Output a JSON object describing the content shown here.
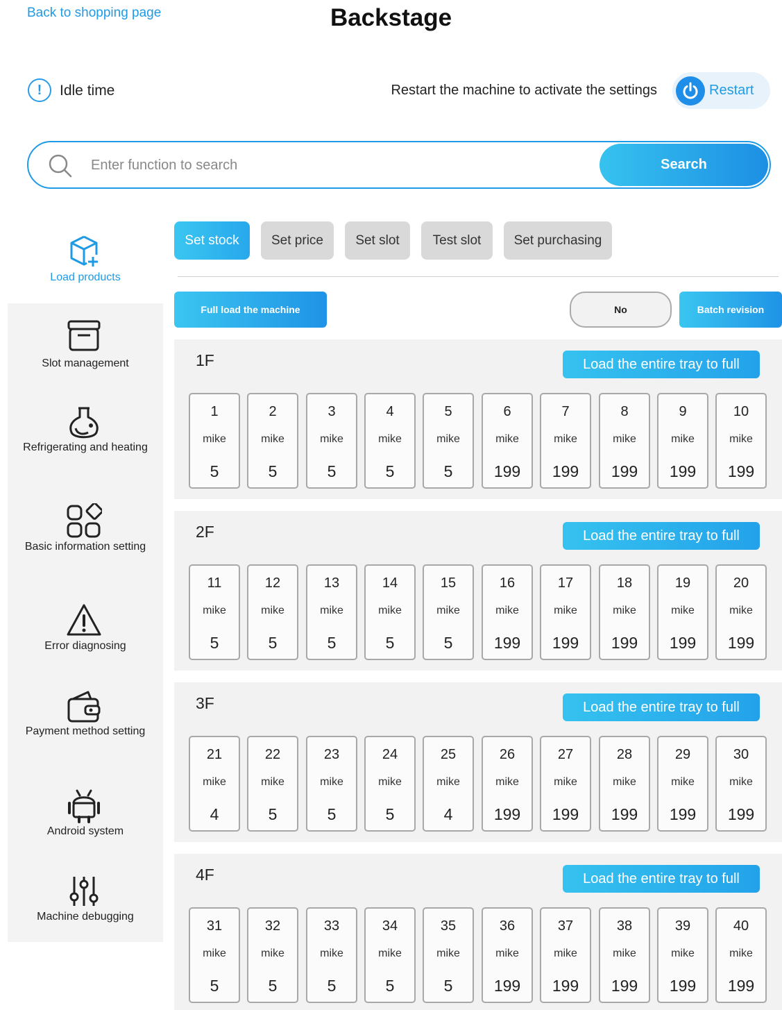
{
  "header": {
    "back_link": "Back to shopping page",
    "title": "Backstage"
  },
  "status": {
    "idle_icon": "!",
    "idle_label": "Idle time",
    "restart_hint": "Restart the machine to activate the settings",
    "restart_label": "Restart"
  },
  "search": {
    "placeholder": "Enter function to search",
    "value": "",
    "button_label": "Search"
  },
  "sidebar": {
    "items": [
      {
        "label": "Load products",
        "icon": "cube-plus-icon",
        "active": true
      },
      {
        "label": "Slot management",
        "icon": "box-icon",
        "active": false
      },
      {
        "label": "Refrigerating and heating",
        "icon": "flask-icon",
        "active": false
      },
      {
        "label": "Basic information setting",
        "icon": "grid-shapes-icon",
        "active": false
      },
      {
        "label": "Error diagnosing",
        "icon": "warning-icon",
        "active": false
      },
      {
        "label": "Payment method setting",
        "icon": "wallet-icon",
        "active": false
      },
      {
        "label": "Android system",
        "icon": "android-icon",
        "active": false
      },
      {
        "label": "Machine debugging",
        "icon": "sliders-icon",
        "active": false
      }
    ]
  },
  "tabs": [
    {
      "label": "Set stock",
      "active": true
    },
    {
      "label": "Set price",
      "active": false
    },
    {
      "label": "Set slot",
      "active": false
    },
    {
      "label": "Test slot",
      "active": false
    },
    {
      "label": "Set purchasing",
      "active": false
    }
  ],
  "actions": {
    "full_load": "Full load the machine",
    "toggle": "No",
    "batch": "Batch revision"
  },
  "floors": [
    {
      "name": "1F",
      "load_label": "Load the entire tray to full",
      "slots": [
        {
          "num": "1",
          "name": "mike",
          "stock": "5"
        },
        {
          "num": "2",
          "name": "mike",
          "stock": "5"
        },
        {
          "num": "3",
          "name": "mike",
          "stock": "5"
        },
        {
          "num": "4",
          "name": "mike",
          "stock": "5"
        },
        {
          "num": "5",
          "name": "mike",
          "stock": "5"
        },
        {
          "num": "6",
          "name": "mike",
          "stock": "199"
        },
        {
          "num": "7",
          "name": "mike",
          "stock": "199"
        },
        {
          "num": "8",
          "name": "mike",
          "stock": "199"
        },
        {
          "num": "9",
          "name": "mike",
          "stock": "199"
        },
        {
          "num": "10",
          "name": "mike",
          "stock": "199"
        }
      ]
    },
    {
      "name": "2F",
      "load_label": "Load the entire tray to full",
      "slots": [
        {
          "num": "11",
          "name": "mike",
          "stock": "5"
        },
        {
          "num": "12",
          "name": "mike",
          "stock": "5"
        },
        {
          "num": "13",
          "name": "mike",
          "stock": "5"
        },
        {
          "num": "14",
          "name": "mike",
          "stock": "5"
        },
        {
          "num": "15",
          "name": "mike",
          "stock": "5"
        },
        {
          "num": "16",
          "name": "mike",
          "stock": "199"
        },
        {
          "num": "17",
          "name": "mike",
          "stock": "199"
        },
        {
          "num": "18",
          "name": "mike",
          "stock": "199"
        },
        {
          "num": "19",
          "name": "mike",
          "stock": "199"
        },
        {
          "num": "20",
          "name": "mike",
          "stock": "199"
        }
      ]
    },
    {
      "name": "3F",
      "load_label": "Load the entire tray to full",
      "slots": [
        {
          "num": "21",
          "name": "mike",
          "stock": "4"
        },
        {
          "num": "22",
          "name": "mike",
          "stock": "5"
        },
        {
          "num": "23",
          "name": "mike",
          "stock": "5"
        },
        {
          "num": "24",
          "name": "mike",
          "stock": "5"
        },
        {
          "num": "25",
          "name": "mike",
          "stock": "4"
        },
        {
          "num": "26",
          "name": "mike",
          "stock": "199"
        },
        {
          "num": "27",
          "name": "mike",
          "stock": "199"
        },
        {
          "num": "28",
          "name": "mike",
          "stock": "199"
        },
        {
          "num": "29",
          "name": "mike",
          "stock": "199"
        },
        {
          "num": "30",
          "name": "mike",
          "stock": "199"
        }
      ]
    },
    {
      "name": "4F",
      "load_label": "Load the entire tray to full",
      "slots": [
        {
          "num": "31",
          "name": "mike",
          "stock": "5"
        },
        {
          "num": "32",
          "name": "mike",
          "stock": "5"
        },
        {
          "num": "33",
          "name": "mike",
          "stock": "5"
        },
        {
          "num": "34",
          "name": "mike",
          "stock": "5"
        },
        {
          "num": "35",
          "name": "mike",
          "stock": "5"
        },
        {
          "num": "36",
          "name": "mike",
          "stock": "199"
        },
        {
          "num": "37",
          "name": "mike",
          "stock": "199"
        },
        {
          "num": "38",
          "name": "mike",
          "stock": "199"
        },
        {
          "num": "39",
          "name": "mike",
          "stock": "199"
        },
        {
          "num": "40",
          "name": "mike",
          "stock": "199"
        }
      ]
    }
  ],
  "colors": {
    "accent": "#1f9be6",
    "button_gradient_start": "#3bc6f1",
    "button_gradient_end": "#1f93e6",
    "panel_bg": "#f2f2f2",
    "tab_inactive": "#d9d9d9"
  }
}
